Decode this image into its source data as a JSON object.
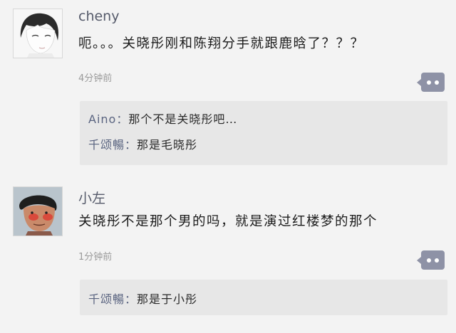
{
  "posts": [
    {
      "username": "cheny",
      "avatar_icon": "cartoon-boy-avatar-icon",
      "content": "呃。。。关晓彤刚和陈翔分手就跟鹿晗了？？？",
      "time": "4分钟前",
      "replies": [
        {
          "user": "Aino",
          "text": "那个不是关晓彤吧…"
        },
        {
          "user": "千颂暢",
          "text": "那是毛晓彤"
        }
      ]
    },
    {
      "username": "小左",
      "avatar_icon": "cartoon-man-avatar-icon",
      "content": "关晓彤不是那个男的吗，就是演过红楼梦的那个",
      "time": "1分钟前",
      "replies": [
        {
          "user": "千颂暢",
          "text": "那是于小彤"
        }
      ]
    }
  ],
  "colors": {
    "background": "#f3f3f3",
    "reply_box": "#e7e7e7",
    "more_button": "#8e92a6",
    "reply_user": "#5a6480"
  }
}
